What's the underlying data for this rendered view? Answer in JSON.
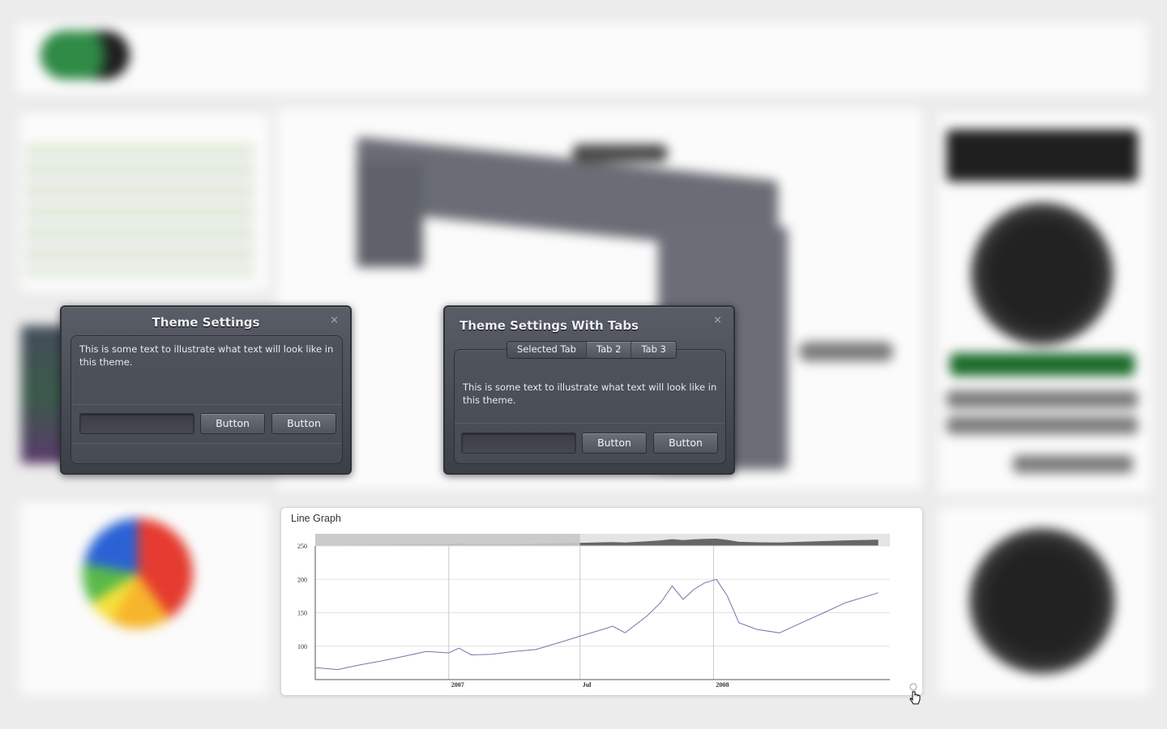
{
  "dialog_plain": {
    "title": "Theme Settings",
    "close_glyph": "×",
    "text": "This is some text to illustrate what text will look like in this theme.",
    "input_value": "",
    "button1": "Button",
    "button2": "Button"
  },
  "dialog_tabs": {
    "title": "Theme Settings With Tabs",
    "close_glyph": "×",
    "tabs": [
      "Selected Tab",
      "Tab 2",
      "Tab 3"
    ],
    "selected_tab": "Selected Tab",
    "text": "This is some text to illustrate what text will look like in this theme.",
    "input_value": "",
    "button1": "Button",
    "button2": "Button"
  },
  "line_graph": {
    "title": "Line Graph",
    "icons": [
      "gear-icon",
      "hand-cursor-icon"
    ]
  },
  "chart_data": {
    "type": "line",
    "title": "Line Graph",
    "xlabel": "",
    "ylabel": "",
    "ylim": [
      50,
      250
    ],
    "yticks": [
      100,
      150,
      200,
      250
    ],
    "xtick_labels": [
      "2007",
      "Jul",
      "2008"
    ],
    "xtick_dates": [
      "2007-01-01",
      "2007-07-01",
      "2008-01-01"
    ],
    "xlim": [
      "2006-07-01",
      "2008-08-31"
    ],
    "grid": true,
    "navigator_range": [
      "2006-07-01",
      "2007-07-01"
    ],
    "series": [
      {
        "x": [
          "2006-07-01",
          "2006-08-01",
          "2006-09-01",
          "2006-10-01",
          "2006-11-01",
          "2006-12-01",
          "2007-01-01",
          "2007-01-15",
          "2007-02-01",
          "2007-03-01",
          "2007-04-01",
          "2007-05-01",
          "2007-06-01",
          "2007-07-01",
          "2007-08-01",
          "2007-08-15",
          "2007-09-01",
          "2007-10-01",
          "2007-10-20",
          "2007-11-05",
          "2007-11-20",
          "2007-12-05",
          "2007-12-20",
          "2008-01-05",
          "2008-01-20",
          "2008-02-05",
          "2008-03-01",
          "2008-04-01",
          "2008-05-01",
          "2008-06-01",
          "2008-07-01",
          "2008-08-15"
        ],
        "y": [
          68,
          65,
          72,
          78,
          85,
          92,
          90,
          97,
          87,
          88,
          92,
          95,
          105,
          115,
          125,
          130,
          120,
          145,
          165,
          190,
          170,
          185,
          195,
          200,
          175,
          135,
          125,
          120,
          135,
          150,
          165,
          180
        ]
      }
    ]
  }
}
